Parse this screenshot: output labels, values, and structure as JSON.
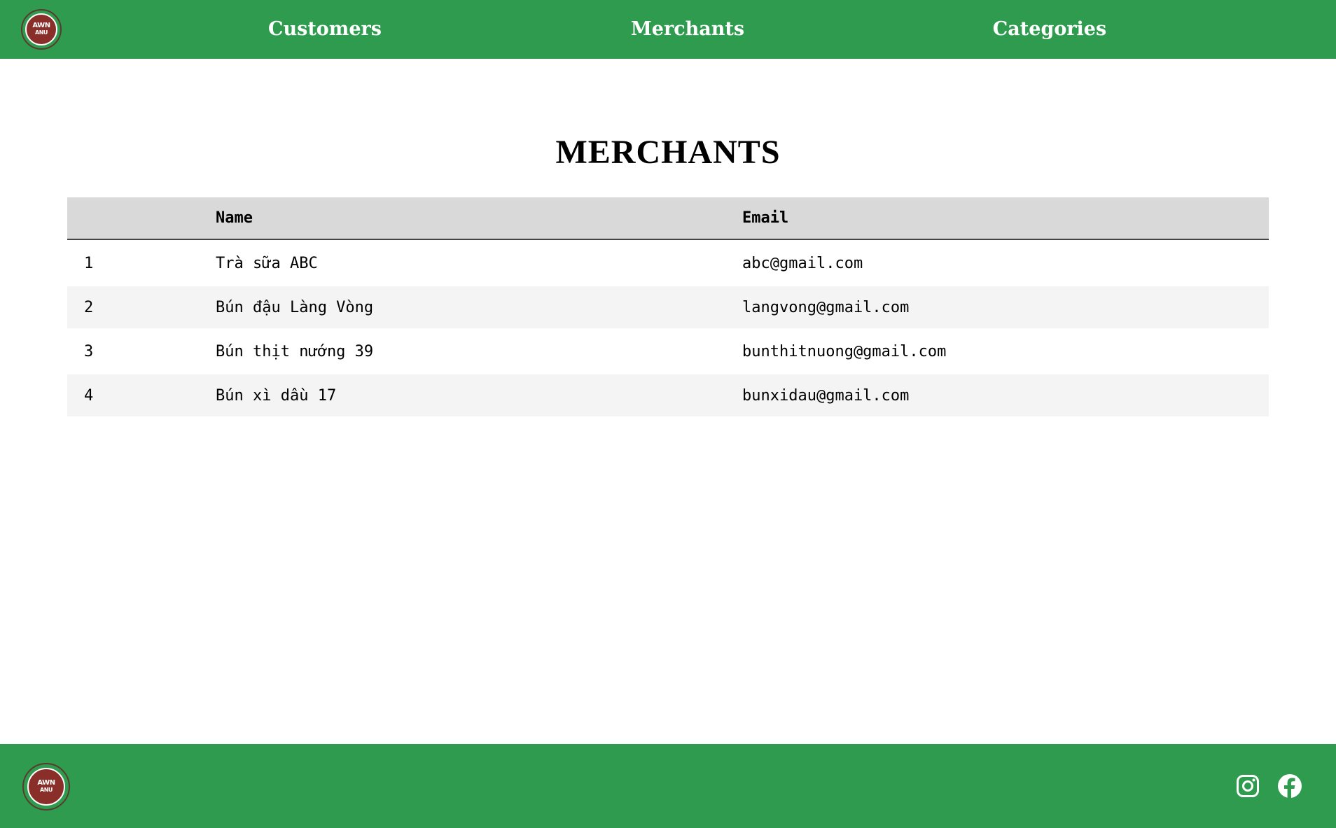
{
  "header": {
    "logo": {
      "line1": "AWN",
      "line2": "ANU"
    },
    "nav": [
      {
        "label": "Customers"
      },
      {
        "label": "Merchants"
      },
      {
        "label": "Categories"
      }
    ]
  },
  "main": {
    "title": "MERCHANTS",
    "table": {
      "columns": [
        "",
        "Name",
        "Email"
      ],
      "rows": [
        {
          "id": "1",
          "name": "Trà sữa ABC",
          "email": "abc@gmail.com"
        },
        {
          "id": "2",
          "name": "Bún đậu Làng Vòng",
          "email": "langvong@gmail.com"
        },
        {
          "id": "3",
          "name": "Bún thịt nướng 39",
          "email": "bunthitnuong@gmail.com"
        },
        {
          "id": "4",
          "name": "Bún xì dầu 17",
          "email": "bunxidau@gmail.com"
        }
      ]
    }
  },
  "footer": {
    "logo": {
      "line1": "AWN",
      "line2": "ANU"
    },
    "social": [
      {
        "icon": "instagram-icon"
      },
      {
        "icon": "facebook-icon"
      }
    ]
  },
  "colors": {
    "brand_green": "#2e9b4f",
    "header_row": "#d9d9d9",
    "alt_row": "#f4f4f4"
  }
}
